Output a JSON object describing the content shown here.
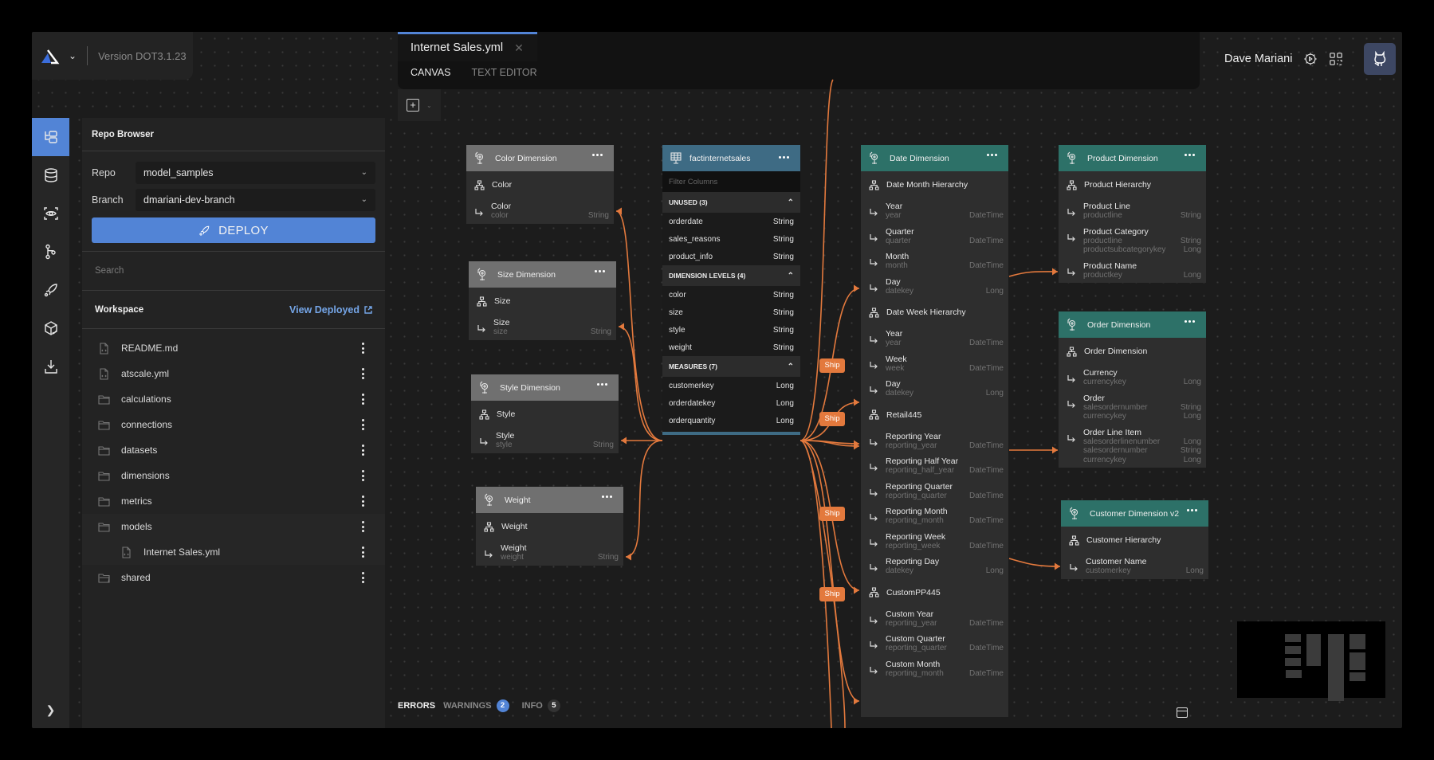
{
  "app": {
    "version": "Version DOT3.1.23"
  },
  "user": {
    "name": "Dave Mariani"
  },
  "rail": {
    "items": [
      "repo-browser",
      "datasets",
      "preview",
      "branches",
      "deploy",
      "packages",
      "download"
    ]
  },
  "repo_browser": {
    "title": "Repo Browser",
    "repo_label": "Repo",
    "repo_value": "model_samples",
    "branch_label": "Branch",
    "branch_value": "dmariani-dev-branch",
    "deploy_label": "DEPLOY",
    "search_placeholder": "Search",
    "workspace_label": "Workspace",
    "view_deployed_label": "View Deployed",
    "tree": [
      {
        "name": "README.md",
        "type": "file"
      },
      {
        "name": "atscale.yml",
        "type": "file"
      },
      {
        "name": "calculations",
        "type": "folder"
      },
      {
        "name": "connections",
        "type": "folder"
      },
      {
        "name": "datasets",
        "type": "folder"
      },
      {
        "name": "dimensions",
        "type": "folder"
      },
      {
        "name": "metrics",
        "type": "folder"
      },
      {
        "name": "models",
        "type": "folder"
      },
      {
        "name": "Internet Sales.yml",
        "type": "file"
      },
      {
        "name": "shared",
        "type": "folder-open"
      }
    ]
  },
  "editor": {
    "tab": "Internet Sales.yml",
    "subtabs": [
      "CANVAS",
      "TEXT EDITOR"
    ]
  },
  "canvas": {
    "fact": {
      "title": "factinternetsales",
      "filter_placeholder": "Filter Columns",
      "sections": [
        {
          "label": "UNUSED (3)",
          "rows": [
            [
              "orderdate",
              "String"
            ],
            [
              "sales_reasons",
              "String"
            ],
            [
              "product_info",
              "String"
            ]
          ]
        },
        {
          "label": "DIMENSION LEVELS (4)",
          "rows": [
            [
              "color",
              "String"
            ],
            [
              "size",
              "String"
            ],
            [
              "style",
              "String"
            ],
            [
              "weight",
              "String"
            ]
          ]
        },
        {
          "label": "MEASURES (7)",
          "rows": [
            [
              "customerkey",
              "Long"
            ],
            [
              "orderdatekey",
              "Long"
            ],
            [
              "orderquantity",
              "Long"
            ]
          ]
        }
      ]
    },
    "dims": {
      "color": {
        "title": "Color Dimension",
        "hier": "Color",
        "levels": [
          {
            "name": "Color",
            "keys": [
              [
                "color",
                "String"
              ]
            ]
          }
        ]
      },
      "size": {
        "title": "Size Dimension",
        "hier": "Size",
        "levels": [
          {
            "name": "Size",
            "keys": [
              [
                "size",
                "String"
              ]
            ]
          }
        ]
      },
      "style": {
        "title": "Style Dimension",
        "hier": "Style",
        "levels": [
          {
            "name": "Style",
            "keys": [
              [
                "style",
                "String"
              ]
            ]
          }
        ]
      },
      "weight": {
        "title": "Weight",
        "hier": "Weight",
        "levels": [
          {
            "name": "Weight",
            "keys": [
              [
                "weight",
                "String"
              ]
            ]
          }
        ]
      },
      "date": {
        "title": "Date Dimension",
        "groups": [
          {
            "hier": "Date Month Hierarchy",
            "levels": [
              {
                "name": "Year",
                "keys": [
                  [
                    "year",
                    "DateTime"
                  ]
                ]
              },
              {
                "name": "Quarter",
                "keys": [
                  [
                    "quarter",
                    "DateTime"
                  ]
                ]
              },
              {
                "name": "Month",
                "keys": [
                  [
                    "month",
                    "DateTime"
                  ]
                ]
              },
              {
                "name": "Day",
                "keys": [
                  [
                    "datekey",
                    "Long"
                  ]
                ]
              }
            ]
          },
          {
            "hier": "Date Week Hierarchy",
            "levels": [
              {
                "name": "Year",
                "keys": [
                  [
                    "year",
                    "DateTime"
                  ]
                ]
              },
              {
                "name": "Week",
                "keys": [
                  [
                    "week",
                    "DateTime"
                  ]
                ]
              },
              {
                "name": "Day",
                "keys": [
                  [
                    "datekey",
                    "Long"
                  ]
                ]
              }
            ]
          },
          {
            "hier": "Retail445",
            "levels": [
              {
                "name": "Reporting Year",
                "keys": [
                  [
                    "reporting_year",
                    "DateTime"
                  ]
                ]
              },
              {
                "name": "Reporting Half Year",
                "keys": [
                  [
                    "reporting_half_year",
                    "DateTime"
                  ]
                ]
              },
              {
                "name": "Reporting Quarter",
                "keys": [
                  [
                    "reporting_quarter",
                    "DateTime"
                  ]
                ]
              },
              {
                "name": "Reporting Month",
                "keys": [
                  [
                    "reporting_month",
                    "DateTime"
                  ]
                ]
              },
              {
                "name": "Reporting Week",
                "keys": [
                  [
                    "reporting_week",
                    "DateTime"
                  ]
                ]
              },
              {
                "name": "Reporting Day",
                "keys": [
                  [
                    "datekey",
                    "Long"
                  ]
                ]
              }
            ]
          },
          {
            "hier": "CustomPP445",
            "levels": [
              {
                "name": "Custom Year",
                "keys": [
                  [
                    "reporting_year",
                    "DateTime"
                  ]
                ]
              },
              {
                "name": "Custom Quarter",
                "keys": [
                  [
                    "reporting_quarter",
                    "DateTime"
                  ]
                ]
              },
              {
                "name": "Custom Month",
                "keys": [
                  [
                    "reporting_month",
                    "DateTime"
                  ]
                ]
              }
            ]
          }
        ]
      },
      "product": {
        "title": "Product Dimension",
        "hier": "Product Hierarchy",
        "levels": [
          {
            "name": "Product Line",
            "keys": [
              [
                "productline",
                "String"
              ]
            ]
          },
          {
            "name": "Product Category",
            "keys": [
              [
                "productline",
                "String"
              ],
              [
                "productsubcategorykey",
                "Long"
              ]
            ]
          },
          {
            "name": "Product Name",
            "keys": [
              [
                "productkey",
                "Long"
              ]
            ]
          }
        ]
      },
      "order": {
        "title": "Order Dimension",
        "hier": "Order Dimension",
        "levels": [
          {
            "name": "Currency",
            "keys": [
              [
                "currencykey",
                "Long"
              ]
            ]
          },
          {
            "name": "Order",
            "keys": [
              [
                "salesordernumber",
                "String"
              ],
              [
                "currencykey",
                "Long"
              ]
            ]
          },
          {
            "name": "Order Line Item",
            "keys": [
              [
                "salesorderlinenumber",
                "Long"
              ],
              [
                "salesordernumber",
                "String"
              ],
              [
                "currencykey",
                "Long"
              ]
            ]
          }
        ]
      },
      "customer": {
        "title": "Customer Dimension v2",
        "hier": "Customer Hierarchy",
        "levels": [
          {
            "name": "Customer Name",
            "keys": [
              [
                "customerkey",
                "Long"
              ]
            ]
          }
        ]
      }
    },
    "ship_label": "Ship",
    "accent_edge": "#e3793d"
  },
  "status": {
    "errors_label": "ERRORS",
    "warnings_label": "WARNINGS",
    "warnings_count": "2",
    "info_label": "INFO",
    "info_count": "5"
  },
  "colors": {
    "accent": "#5284d6",
    "dim_gray": "#707070",
    "dim_teal": "#2d7168",
    "fact_blue": "#3e6b84",
    "edge": "#e3793d"
  }
}
